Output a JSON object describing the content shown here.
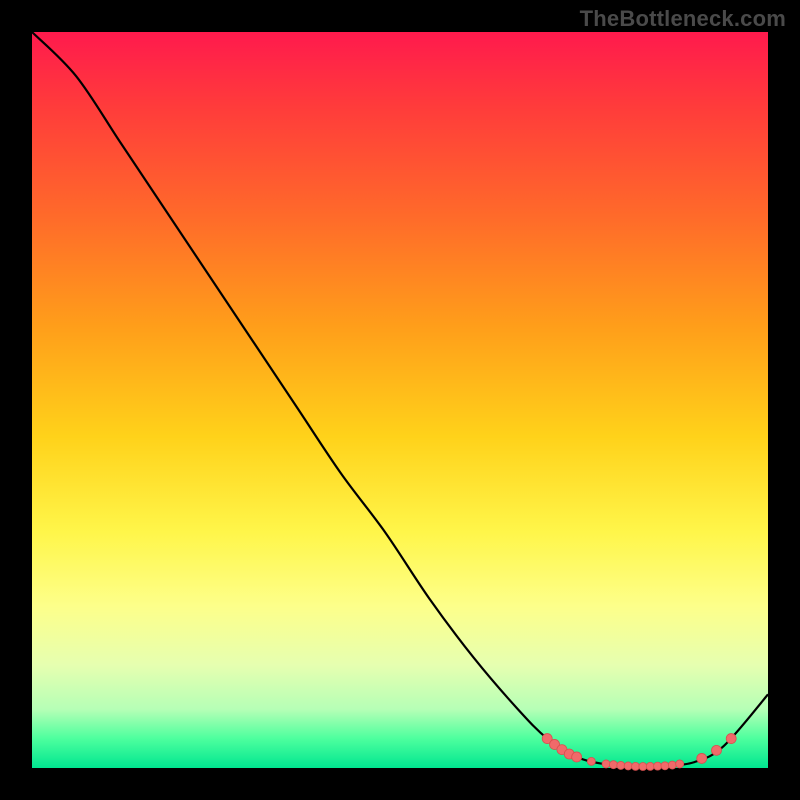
{
  "watermark": {
    "text": "TheBottleneck.com"
  },
  "colors": {
    "frame_bg": "#000000",
    "line": "#000000",
    "marker_fill": "#f06a6a",
    "marker_stroke": "#d94f4f"
  },
  "chart_data": {
    "type": "line",
    "title": "",
    "xlabel": "",
    "ylabel": "",
    "xlim": [
      0,
      100
    ],
    "ylim": [
      0,
      100
    ],
    "grid": false,
    "series": [
      {
        "name": "bottleneck-curve",
        "x": [
          0,
          6,
          12,
          18,
          24,
          30,
          36,
          42,
          48,
          54,
          60,
          66,
          70,
          74,
          78,
          82,
          86,
          90,
          94,
          100
        ],
        "y": [
          100,
          94,
          85,
          76,
          67,
          58,
          49,
          40,
          32,
          23,
          15,
          8,
          4,
          1.5,
          0.5,
          0.2,
          0.3,
          0.8,
          3,
          10
        ]
      }
    ],
    "markers": [
      {
        "x": 70,
        "y": 4.0,
        "r": 5
      },
      {
        "x": 71,
        "y": 3.2,
        "r": 5
      },
      {
        "x": 72,
        "y": 2.5,
        "r": 5
      },
      {
        "x": 73,
        "y": 1.9,
        "r": 5
      },
      {
        "x": 74,
        "y": 1.5,
        "r": 5
      },
      {
        "x": 76,
        "y": 0.9,
        "r": 4
      },
      {
        "x": 78,
        "y": 0.55,
        "r": 4
      },
      {
        "x": 79,
        "y": 0.45,
        "r": 4
      },
      {
        "x": 80,
        "y": 0.35,
        "r": 4
      },
      {
        "x": 81,
        "y": 0.28,
        "r": 4
      },
      {
        "x": 82,
        "y": 0.22,
        "r": 4
      },
      {
        "x": 83,
        "y": 0.2,
        "r": 4
      },
      {
        "x": 84,
        "y": 0.22,
        "r": 4
      },
      {
        "x": 85,
        "y": 0.25,
        "r": 4
      },
      {
        "x": 86,
        "y": 0.3,
        "r": 4
      },
      {
        "x": 87,
        "y": 0.4,
        "r": 4
      },
      {
        "x": 88,
        "y": 0.55,
        "r": 4
      },
      {
        "x": 91,
        "y": 1.3,
        "r": 5
      },
      {
        "x": 93,
        "y": 2.4,
        "r": 5
      },
      {
        "x": 95,
        "y": 4.0,
        "r": 5
      }
    ]
  }
}
